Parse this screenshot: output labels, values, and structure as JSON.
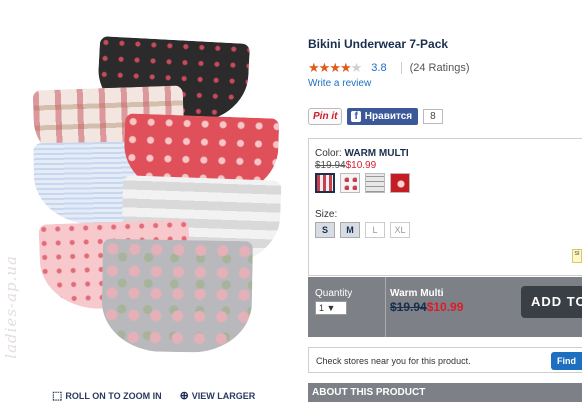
{
  "product": {
    "title": "Bikini Underwear 7-Pack",
    "rating_value": "3.8",
    "rating_stars": 4,
    "rating_count": "(24 Ratings)",
    "write_review": "Write a review"
  },
  "social": {
    "pinit": "Pin it",
    "facebook_label": "Нравится",
    "facebook_icon": "f",
    "facebook_count": "8"
  },
  "options": {
    "color_prefix": "Color:",
    "color_name": "WARM MULTI",
    "old_price": "$19.94",
    "new_price": "$10.99",
    "swatches": [
      "warm-multi",
      "white-floral",
      "grey-plaid",
      "red-floral"
    ],
    "size_label": "Size:",
    "sizes": [
      {
        "label": "S",
        "available": true
      },
      {
        "label": "M",
        "available": true
      },
      {
        "label": "L",
        "available": false
      },
      {
        "label": "XL",
        "available": false
      }
    ],
    "size_hint": "si"
  },
  "buybar": {
    "quantity_label": "Quantity",
    "quantity_value": "1 ▼",
    "variant_name": "Warm Multi",
    "old_price": "$19.94",
    "new_price": "$10.99",
    "add_button": "ADD TO"
  },
  "stores": {
    "text": "Check stores near you for this product.",
    "button": "Find"
  },
  "about": "ABOUT THIS PRODUCT",
  "image": {
    "roll_zoom": "ROLL ON TO ZOOM IN",
    "view_larger": "VIEW LARGER",
    "watermark": "ladies-ap.ua"
  },
  "colors": {
    "navy": "#1a2e4e",
    "link": "#1e6fbf",
    "sale": "#d81e2c",
    "star": "#e05a18",
    "bar": "#7d8086"
  }
}
